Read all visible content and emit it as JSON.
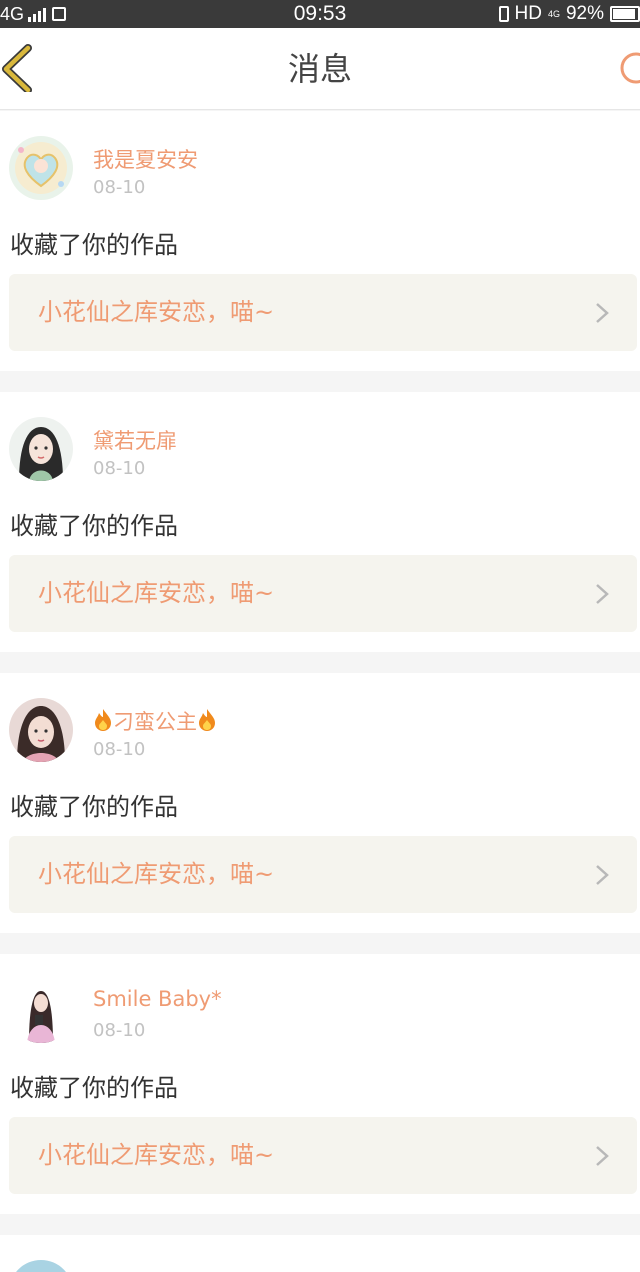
{
  "status_bar": {
    "network": "4G",
    "time": "09:53",
    "hd_label": "HD",
    "net_speed": "4G",
    "battery": "92%"
  },
  "nav": {
    "title": "消息",
    "back_icon": "chevron-left-icon",
    "refresh_icon": "refresh-icon"
  },
  "messages": [
    {
      "username": "我是夏安安",
      "date": "08-10",
      "action": "收藏了你的作品",
      "work_title": "小花仙之库安恋，喵~"
    },
    {
      "username": "黛若无扉",
      "date": "08-10",
      "action": "收藏了你的作品",
      "work_title": "小花仙之库安恋，喵~"
    },
    {
      "username": "刁蛮公主",
      "date": "08-10",
      "action": "收藏了你的作品",
      "work_title": "小花仙之库安恋，喵~"
    },
    {
      "username": "Smile Baby*",
      "date": "08-10",
      "action": "收藏了你的作品",
      "work_title": "小花仙之库安恋，喵~"
    }
  ],
  "colors": {
    "accent": "#ef9b73",
    "back_icon": "#d9b83c",
    "work_bg": "#f5f4ee",
    "page_bg": "#f5f5f5"
  }
}
